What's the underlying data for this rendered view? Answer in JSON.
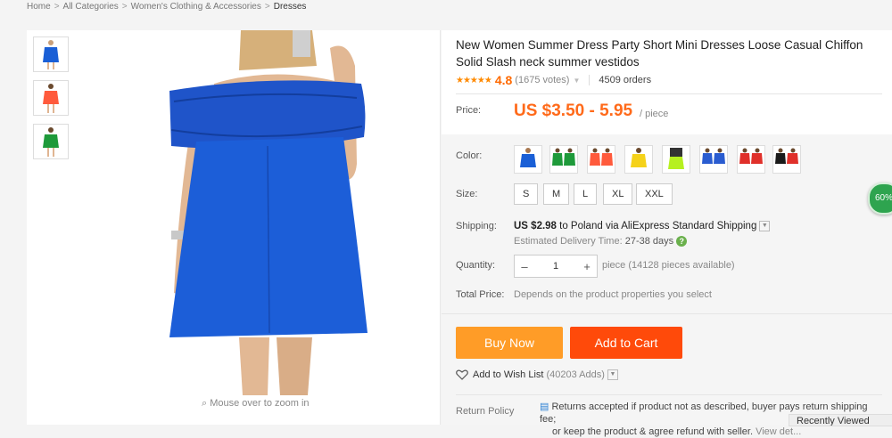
{
  "breadcrumb": {
    "items": [
      "Home",
      "All Categories",
      "Women's Clothing & Accessories",
      "Dresses"
    ],
    "separator": ">"
  },
  "gallery": {
    "thumbnails": [
      {
        "color": "#1a5fd6"
      },
      {
        "color": "#ff5a3c"
      },
      {
        "color": "#1e9a3a"
      }
    ],
    "zoom_hint": "Mouse over to zoom in"
  },
  "product": {
    "title": "New Women Summer Dress Party Short Mini Dresses Loose Casual Chiffon Solid Slash neck summer vestidos",
    "stars": "★★★★★",
    "rating": "4.8",
    "votes": "(1675 votes)",
    "orders": "4509 orders",
    "price_label": "Price:",
    "price": "US $3.50 - 5.95",
    "per_unit": "/ piece"
  },
  "options": {
    "color_label": "Color:",
    "colors": [
      {
        "name": "blue",
        "hex": "#1a5fd6"
      },
      {
        "name": "green",
        "hex": "#1e9a3a"
      },
      {
        "name": "orange",
        "hex": "#ff5a3c"
      },
      {
        "name": "yellow",
        "hex": "#f5d21a"
      },
      {
        "name": "neon-green",
        "hex": "#b6f020"
      },
      {
        "name": "blue-pair",
        "hex": "#2a5cd0"
      },
      {
        "name": "red",
        "hex": "#e0302a"
      },
      {
        "name": "black",
        "hex": "#1a1a1a"
      }
    ],
    "size_label": "Size:",
    "sizes": [
      "S",
      "M",
      "L",
      "XL",
      "XXL"
    ],
    "shipping_label": "Shipping:",
    "shipping_cost": "US $2.98",
    "shipping_rest": " to Poland via AliExpress Standard Shipping",
    "delivery_label": "Estimated Delivery Time:",
    "delivery_days": "27-38 days",
    "quantity_label": "Quantity:",
    "quantity_value": "1",
    "availability": "piece (14128 pieces available)",
    "total_label": "Total Price:",
    "total_text": "Depends on the product properties you select"
  },
  "actions": {
    "buy_now": "Buy Now",
    "add_to_cart": "Add to Cart",
    "wishlist": "Add to Wish List",
    "wishlist_count": "(40203 Adds)"
  },
  "returns": {
    "label": "Return Policy",
    "text_line1": "Returns accepted if product not as described, buyer pays return shipping fee;",
    "text_line2": "or keep the product & agree refund with seller.",
    "view_details": "View det..."
  },
  "widgets": {
    "badge": "60%",
    "recently_viewed": "Recently Viewed"
  }
}
